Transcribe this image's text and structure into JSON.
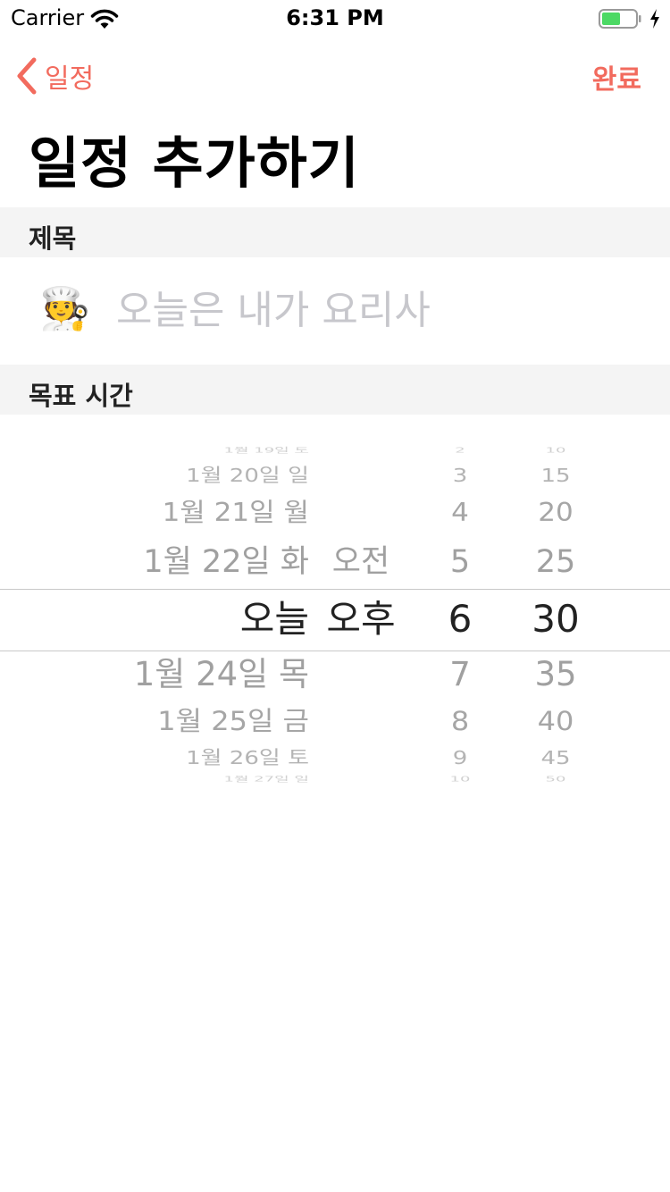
{
  "status_bar": {
    "carrier": "Carrier",
    "time": "6:31 PM"
  },
  "nav": {
    "back_label": "일정",
    "done_label": "완료"
  },
  "page_title": "일정 추가하기",
  "section_title": {
    "label": "제목"
  },
  "title_field": {
    "emoji": "🧑‍🍳",
    "placeholder": "오늘은 내가 요리사",
    "value": ""
  },
  "section_time": {
    "label": "목표 시간"
  },
  "picker": {
    "dates": [
      "1월 19일 토",
      "1월 20일 일",
      "1월 21일 월",
      "1월 22일 화",
      "오늘",
      "1월 24일 목",
      "1월 25일 금",
      "1월 26일 토",
      "1월 27일 일"
    ],
    "ampm": [
      "",
      "",
      "",
      "오전",
      "오후",
      "",
      "",
      "",
      ""
    ],
    "hours": [
      "2",
      "3",
      "4",
      "5",
      "6",
      "7",
      "8",
      "9",
      "10"
    ],
    "minutes": [
      "10",
      "15",
      "20",
      "25",
      "30",
      "35",
      "40",
      "45",
      "50"
    ],
    "selected_index": 4
  },
  "colors": {
    "accent": "#f26b5e",
    "section_bg": "#f4f4f4",
    "placeholder": "#c7c7cc"
  },
  "icons": [
    "wifi-icon",
    "battery-icon",
    "charging-bolt-icon",
    "chevron-left-icon"
  ]
}
